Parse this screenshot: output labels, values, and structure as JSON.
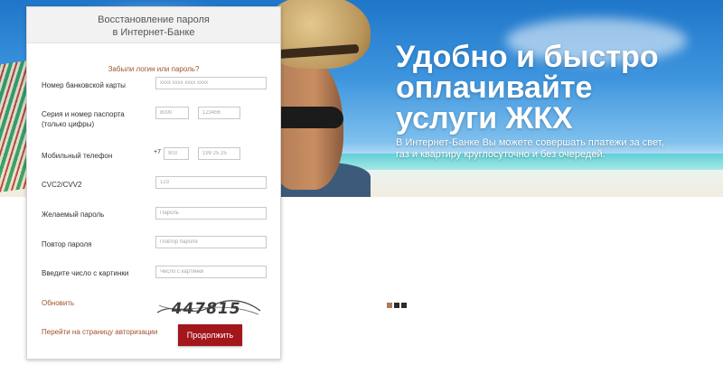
{
  "panel": {
    "title_line1": "Восстановление пароля",
    "title_line2": "в Интернет-Банке",
    "forgot_link": "Забыли логин или пароль?"
  },
  "form": {
    "card_label": "Номер банковской карты",
    "card_placeholder": "хххх хххх хххх хххх",
    "passport_label_line1": "Серия и номер паспорта",
    "passport_label_line2": "(только цифры)",
    "passport_series_placeholder": "8000",
    "passport_number_placeholder": "123456",
    "phone_label": "Мобильный телефон",
    "phone_prefix": "+7",
    "phone_code_placeholder": "903",
    "phone_number_placeholder": "199 25 25",
    "cvc_label": "CVC2/CVV2",
    "cvc_placeholder": "123",
    "password_label": "Желаемый пароль",
    "password_placeholder": "Пароль",
    "password_repeat_label": "Повтор пароля",
    "password_repeat_placeholder": "Повтор пароля",
    "captcha_label": "Введите число с картинки",
    "captcha_placeholder": "Число с картинки",
    "refresh_link": "Обновить",
    "captcha_text": "447815",
    "auth_link": "Перейти на страницу авторизации",
    "continue_button": "Продолжить"
  },
  "hero": {
    "title_line1": "Удобно и быстро",
    "title_line2": "оплачивайте",
    "title_line3": "услуги ЖКХ",
    "subtitle_line1": "В Интернет-Банке Вы можете совершать платежи за свет,",
    "subtitle_line2": "газ и квартиру круглосуточно и без очередей."
  },
  "slider": {
    "count": 3,
    "active_index": 0
  },
  "colors": {
    "accent": "#a3161c",
    "link": "#a0522d",
    "active_dot": "#b07a55"
  }
}
